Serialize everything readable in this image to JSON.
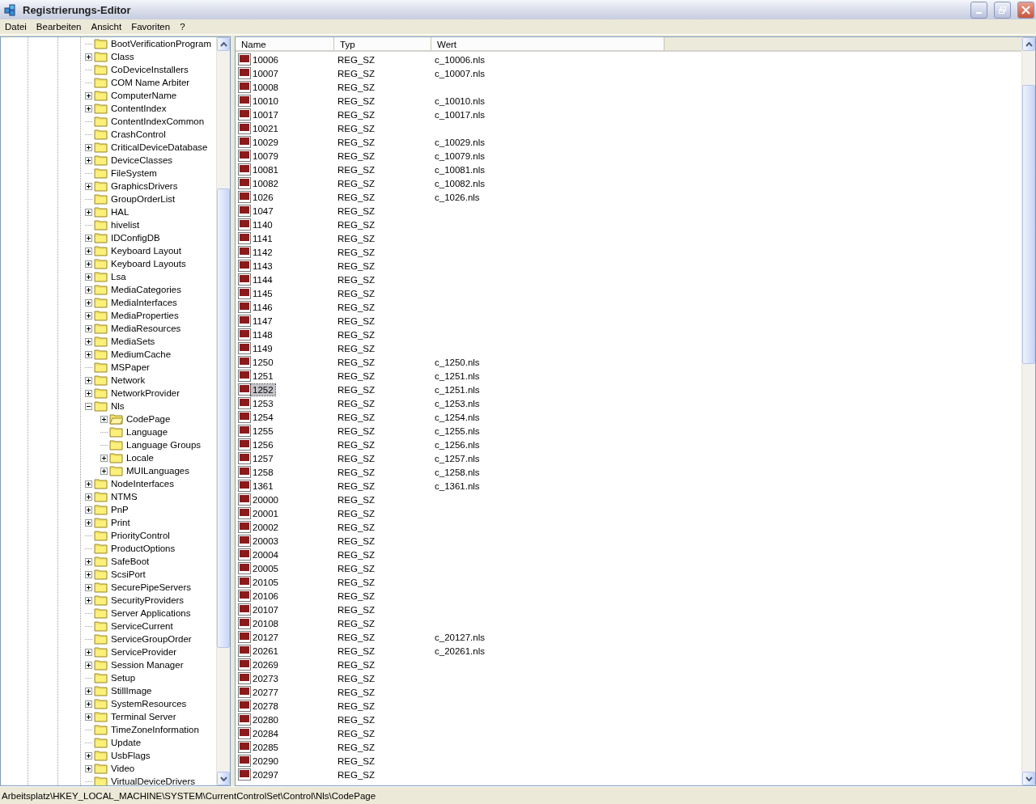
{
  "window": {
    "title": "Registrierungs-Editor"
  },
  "menu": [
    "Datei",
    "Bearbeiten",
    "Ansicht",
    "Favoriten",
    "?"
  ],
  "tree": [
    {
      "label": "BootVerificationProgram",
      "kind": "leaf",
      "selected": false
    },
    {
      "label": "Class",
      "kind": "collapsed",
      "selected": false
    },
    {
      "label": "CoDeviceInstallers",
      "kind": "leaf",
      "selected": false
    },
    {
      "label": "COM Name Arbiter",
      "kind": "leaf",
      "selected": false
    },
    {
      "label": "ComputerName",
      "kind": "collapsed",
      "selected": false
    },
    {
      "label": "ContentIndex",
      "kind": "collapsed",
      "selected": false
    },
    {
      "label": "ContentIndexCommon",
      "kind": "leaf",
      "selected": false
    },
    {
      "label": "CrashControl",
      "kind": "leaf",
      "selected": false
    },
    {
      "label": "CriticalDeviceDatabase",
      "kind": "collapsed",
      "selected": false
    },
    {
      "label": "DeviceClasses",
      "kind": "collapsed",
      "selected": false
    },
    {
      "label": "FileSystem",
      "kind": "leaf",
      "selected": false
    },
    {
      "label": "GraphicsDrivers",
      "kind": "collapsed",
      "selected": false
    },
    {
      "label": "GroupOrderList",
      "kind": "leaf",
      "selected": false
    },
    {
      "label": "HAL",
      "kind": "collapsed",
      "selected": false
    },
    {
      "label": "hivelist",
      "kind": "leaf",
      "selected": false
    },
    {
      "label": "IDConfigDB",
      "kind": "collapsed",
      "selected": false
    },
    {
      "label": "Keyboard Layout",
      "kind": "collapsed",
      "selected": false
    },
    {
      "label": "Keyboard Layouts",
      "kind": "collapsed",
      "selected": false
    },
    {
      "label": "Lsa",
      "kind": "collapsed",
      "selected": false
    },
    {
      "label": "MediaCategories",
      "kind": "collapsed",
      "selected": false
    },
    {
      "label": "MediaInterfaces",
      "kind": "collapsed",
      "selected": false
    },
    {
      "label": "MediaProperties",
      "kind": "collapsed",
      "selected": false
    },
    {
      "label": "MediaResources",
      "kind": "collapsed",
      "selected": false
    },
    {
      "label": "MediaSets",
      "kind": "collapsed",
      "selected": false
    },
    {
      "label": "MediumCache",
      "kind": "collapsed",
      "selected": false
    },
    {
      "label": "MSPaper",
      "kind": "leaf",
      "selected": false
    },
    {
      "label": "Network",
      "kind": "collapsed",
      "selected": false
    },
    {
      "label": "NetworkProvider",
      "kind": "collapsed",
      "selected": false
    },
    {
      "label": "Nls",
      "kind": "expanded",
      "selected": false,
      "children": [
        {
          "label": "CodePage",
          "kind": "collapsed",
          "selected": true
        },
        {
          "label": "Language",
          "kind": "leaf",
          "selected": false
        },
        {
          "label": "Language Groups",
          "kind": "leaf",
          "selected": false
        },
        {
          "label": "Locale",
          "kind": "collapsed",
          "selected": false
        },
        {
          "label": "MUILanguages",
          "kind": "collapsed",
          "selected": false
        }
      ]
    },
    {
      "label": "NodeInterfaces",
      "kind": "collapsed",
      "selected": false
    },
    {
      "label": "NTMS",
      "kind": "collapsed",
      "selected": false
    },
    {
      "label": "PnP",
      "kind": "collapsed",
      "selected": false
    },
    {
      "label": "Print",
      "kind": "collapsed",
      "selected": false
    },
    {
      "label": "PriorityControl",
      "kind": "leaf",
      "selected": false
    },
    {
      "label": "ProductOptions",
      "kind": "leaf",
      "selected": false
    },
    {
      "label": "SafeBoot",
      "kind": "collapsed",
      "selected": false
    },
    {
      "label": "ScsiPort",
      "kind": "collapsed",
      "selected": false
    },
    {
      "label": "SecurePipeServers",
      "kind": "collapsed",
      "selected": false
    },
    {
      "label": "SecurityProviders",
      "kind": "collapsed",
      "selected": false
    },
    {
      "label": "Server Applications",
      "kind": "leaf",
      "selected": false
    },
    {
      "label": "ServiceCurrent",
      "kind": "leaf",
      "selected": false
    },
    {
      "label": "ServiceGroupOrder",
      "kind": "leaf",
      "selected": false
    },
    {
      "label": "ServiceProvider",
      "kind": "collapsed",
      "selected": false
    },
    {
      "label": "Session Manager",
      "kind": "collapsed",
      "selected": false
    },
    {
      "label": "Setup",
      "kind": "leaf",
      "selected": false
    },
    {
      "label": "StillImage",
      "kind": "collapsed",
      "selected": false
    },
    {
      "label": "SystemResources",
      "kind": "collapsed",
      "selected": false
    },
    {
      "label": "Terminal Server",
      "kind": "collapsed",
      "selected": false
    },
    {
      "label": "TimeZoneInformation",
      "kind": "leaf",
      "selected": false
    },
    {
      "label": "Update",
      "kind": "leaf",
      "selected": false
    },
    {
      "label": "UsbFlags",
      "kind": "collapsed",
      "selected": false
    },
    {
      "label": "Video",
      "kind": "collapsed",
      "selected": false
    },
    {
      "label": "VirtualDeviceDrivers",
      "kind": "leaf",
      "selected": false
    }
  ],
  "table": {
    "columns": [
      "Name",
      "Typ",
      "Wert"
    ],
    "rows": [
      {
        "name": "10006",
        "type": "REG_SZ",
        "value": "c_10006.nls",
        "selected": false
      },
      {
        "name": "10007",
        "type": "REG_SZ",
        "value": "c_10007.nls",
        "selected": false
      },
      {
        "name": "10008",
        "type": "REG_SZ",
        "selected": false
      },
      {
        "name": "10010",
        "type": "REG_SZ",
        "value": "c_10010.nls",
        "selected": false
      },
      {
        "name": "10017",
        "type": "REG_SZ",
        "value": "c_10017.nls",
        "selected": false
      },
      {
        "name": "10021",
        "type": "REG_SZ",
        "selected": false
      },
      {
        "name": "10029",
        "type": "REG_SZ",
        "value": "c_10029.nls",
        "selected": false
      },
      {
        "name": "10079",
        "type": "REG_SZ",
        "value": "c_10079.nls",
        "selected": false
      },
      {
        "name": "10081",
        "type": "REG_SZ",
        "value": "c_10081.nls",
        "selected": false
      },
      {
        "name": "10082",
        "type": "REG_SZ",
        "value": "c_10082.nls",
        "selected": false
      },
      {
        "name": "1026",
        "type": "REG_SZ",
        "value": "c_1026.nls",
        "selected": false
      },
      {
        "name": "1047",
        "type": "REG_SZ",
        "selected": false
      },
      {
        "name": "1140",
        "type": "REG_SZ",
        "selected": false
      },
      {
        "name": "1141",
        "type": "REG_SZ",
        "selected": false
      },
      {
        "name": "1142",
        "type": "REG_SZ",
        "selected": false
      },
      {
        "name": "1143",
        "type": "REG_SZ",
        "selected": false
      },
      {
        "name": "1144",
        "type": "REG_SZ",
        "selected": false
      },
      {
        "name": "1145",
        "type": "REG_SZ",
        "selected": false
      },
      {
        "name": "1146",
        "type": "REG_SZ",
        "selected": false
      },
      {
        "name": "1147",
        "type": "REG_SZ",
        "selected": false
      },
      {
        "name": "1148",
        "type": "REG_SZ",
        "selected": false
      },
      {
        "name": "1149",
        "type": "REG_SZ",
        "selected": false
      },
      {
        "name": "1250",
        "type": "REG_SZ",
        "value": "c_1250.nls",
        "selected": false
      },
      {
        "name": "1251",
        "type": "REG_SZ",
        "value": "c_1251.nls",
        "selected": false
      },
      {
        "name": "1252",
        "type": "REG_SZ",
        "value": "c_1251.nls",
        "selected": true
      },
      {
        "name": "1253",
        "type": "REG_SZ",
        "value": "c_1253.nls",
        "selected": false
      },
      {
        "name": "1254",
        "type": "REG_SZ",
        "value": "c_1254.nls",
        "selected": false
      },
      {
        "name": "1255",
        "type": "REG_SZ",
        "value": "c_1255.nls",
        "selected": false
      },
      {
        "name": "1256",
        "type": "REG_SZ",
        "value": "c_1256.nls",
        "selected": false
      },
      {
        "name": "1257",
        "type": "REG_SZ",
        "value": "c_1257.nls",
        "selected": false
      },
      {
        "name": "1258",
        "type": "REG_SZ",
        "value": "c_1258.nls",
        "selected": false
      },
      {
        "name": "1361",
        "type": "REG_SZ",
        "value": "c_1361.nls",
        "selected": false
      },
      {
        "name": "20000",
        "type": "REG_SZ",
        "selected": false
      },
      {
        "name": "20001",
        "type": "REG_SZ",
        "selected": false
      },
      {
        "name": "20002",
        "type": "REG_SZ",
        "selected": false
      },
      {
        "name": "20003",
        "type": "REG_SZ",
        "selected": false
      },
      {
        "name": "20004",
        "type": "REG_SZ",
        "selected": false
      },
      {
        "name": "20005",
        "type": "REG_SZ",
        "selected": false
      },
      {
        "name": "20105",
        "type": "REG_SZ",
        "selected": false
      },
      {
        "name": "20106",
        "type": "REG_SZ",
        "selected": false
      },
      {
        "name": "20107",
        "type": "REG_SZ",
        "selected": false
      },
      {
        "name": "20108",
        "type": "REG_SZ",
        "selected": false
      },
      {
        "name": "20127",
        "type": "REG_SZ",
        "value": "c_20127.nls",
        "selected": false
      },
      {
        "name": "20261",
        "type": "REG_SZ",
        "value": "c_20261.nls",
        "selected": false
      },
      {
        "name": "20269",
        "type": "REG_SZ",
        "selected": false
      },
      {
        "name": "20273",
        "type": "REG_SZ",
        "selected": false
      },
      {
        "name": "20277",
        "type": "REG_SZ",
        "selected": false
      },
      {
        "name": "20278",
        "type": "REG_SZ",
        "selected": false
      },
      {
        "name": "20280",
        "type": "REG_SZ",
        "selected": false
      },
      {
        "name": "20284",
        "type": "REG_SZ",
        "selected": false
      },
      {
        "name": "20285",
        "type": "REG_SZ",
        "selected": false
      },
      {
        "name": "20290",
        "type": "REG_SZ",
        "selected": false
      },
      {
        "name": "20297",
        "type": "REG_SZ",
        "selected": false
      }
    ]
  },
  "status_bar": "Arbeitsplatz\\HKEY_LOCAL_MACHINE\\SYSTEM\\CurrentControlSet\\Control\\Nls\\CodePage"
}
